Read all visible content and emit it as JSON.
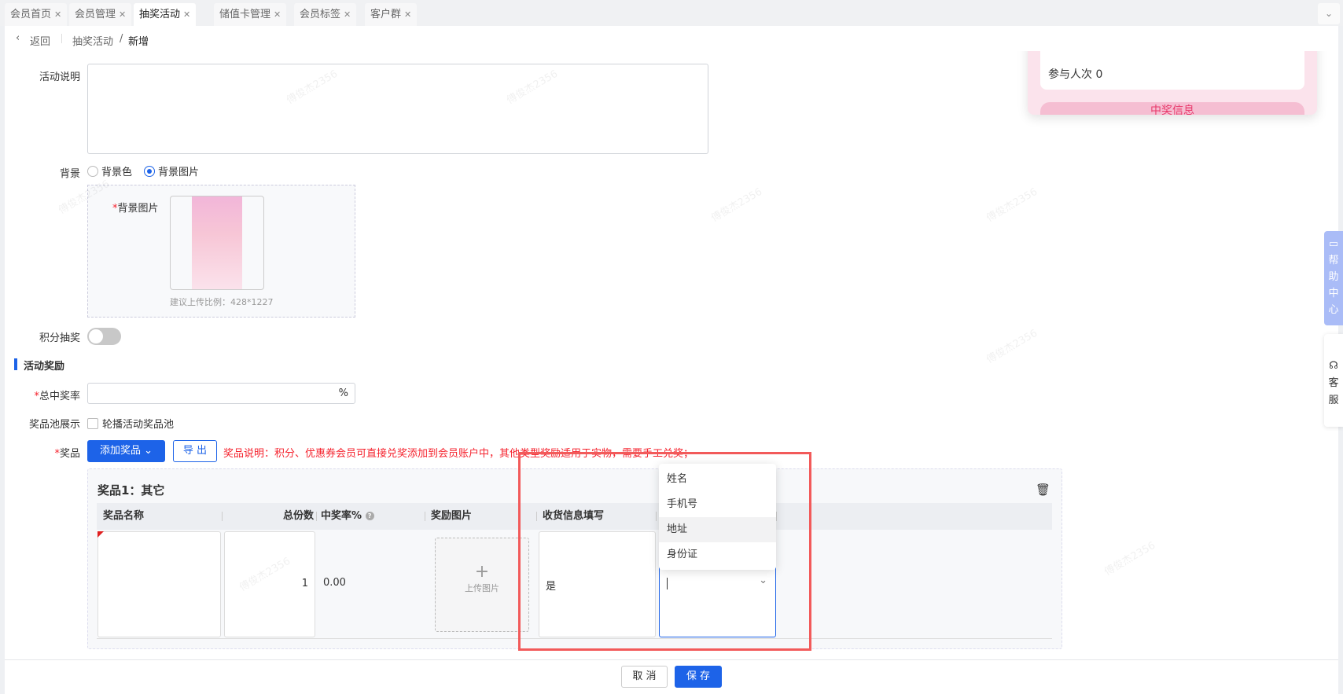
{
  "tabs": [
    {
      "label": "会员首页"
    },
    {
      "label": "会员管理"
    },
    {
      "label": "抽奖活动",
      "active": true
    },
    {
      "label": "储值卡管理"
    },
    {
      "label": "会员标签"
    },
    {
      "label": "客户群"
    }
  ],
  "breadcrumb": {
    "back": "返回",
    "parent": "抽奖活动",
    "current": "新增"
  },
  "form": {
    "description_label": "活动说明",
    "background_label": "背景",
    "background_options": [
      "背景色",
      "背景图片"
    ],
    "background_selected": "背景图片",
    "bg_image_label": "背景图片",
    "bg_image_hint": "建议上传比例：428*1227",
    "points_draw_label": "积分抽奖",
    "points_draw_on": false,
    "section_title": "活动奖励",
    "total_rate_label": "总中奖率",
    "total_rate_value": "",
    "total_rate_unit": "%",
    "pool_label": "奖品池展示",
    "pool_checkbox": "轮播活动奖品池",
    "pool_checked": false,
    "prize_label": "奖品",
    "add_prize_button": "添加奖品",
    "export_button": "导 出",
    "prize_note": "奖品说明：积分、优惠券会员可直接兑奖添加到会员账户中，其他类型奖励适用于实物，需要手工兑奖；"
  },
  "prize_card": {
    "title": "奖品1：其它",
    "columns": [
      "奖品名称",
      "总份数",
      "中奖率%",
      "奖励图片",
      "收货信息填写",
      ""
    ],
    "row": {
      "name": "",
      "total": "1",
      "rate": "0.00",
      "upload_label": "上传图片",
      "shipping": "是",
      "info_field": ""
    }
  },
  "dropdown": {
    "options": [
      "姓名",
      "手机号",
      "地址",
      "身份证"
    ],
    "hovered": "地址"
  },
  "preview": {
    "participants": "参与人次 0",
    "winner_tab": "中奖信息"
  },
  "side": {
    "help": "帮助中心",
    "service": "客服"
  },
  "footer": {
    "cancel": "取 消",
    "save": "保 存"
  },
  "watermark": "傅俊杰2356",
  "colors": {
    "primary": "#1d63e8",
    "danger": "#f5222d",
    "highlight_box": "#f25a5a"
  }
}
